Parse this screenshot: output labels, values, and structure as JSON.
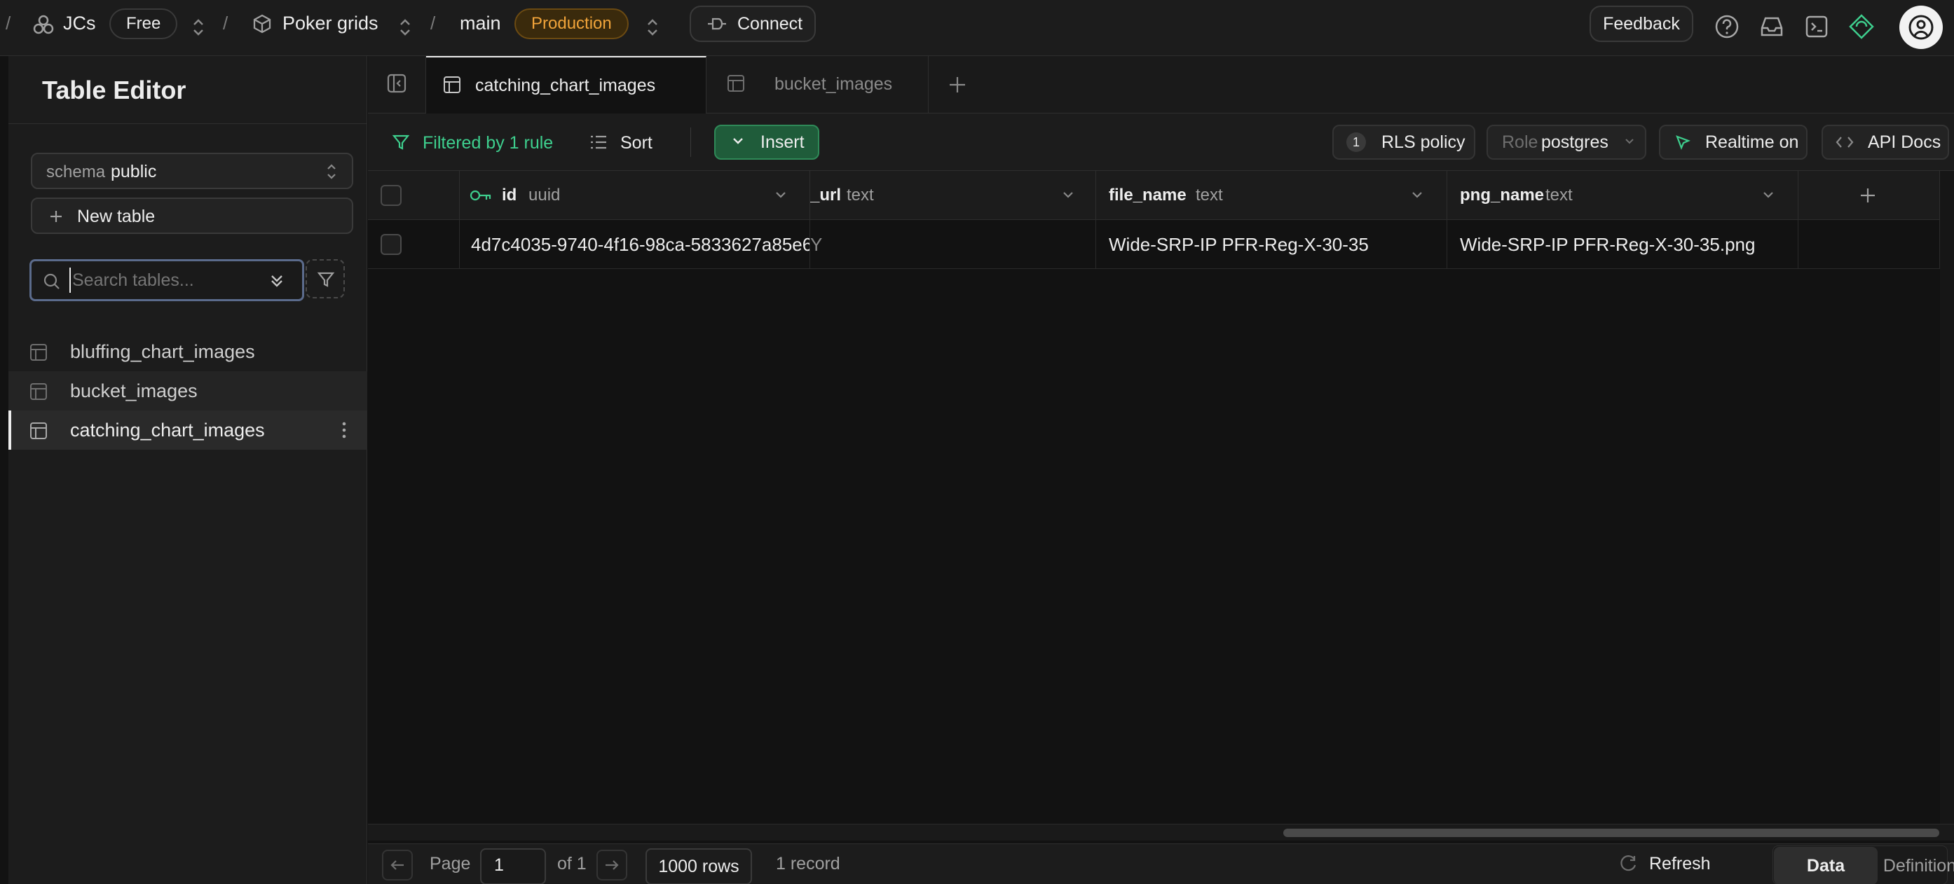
{
  "topbar": {
    "org_name": "JCs",
    "plan_badge": "Free",
    "project_name": "Poker grids",
    "branch_name": "main",
    "env_badge": "Production",
    "connect_label": "Connect",
    "feedback_label": "Feedback"
  },
  "sidebar": {
    "title": "Table Editor",
    "schema_label": "schema",
    "schema_value": "public",
    "new_table_label": "New table",
    "search_placeholder": "Search tables...",
    "tables": [
      {
        "name": "bluffing_chart_images"
      },
      {
        "name": "bucket_images"
      },
      {
        "name": "catching_chart_images"
      }
    ]
  },
  "tabs": [
    {
      "label": "catching_chart_images",
      "active": true
    },
    {
      "label": "bucket_images",
      "active": false
    }
  ],
  "toolbar": {
    "filter_label": "Filtered by 1 rule",
    "sort_label": "Sort",
    "insert_label": "Insert",
    "rls_count": "1",
    "rls_label": "RLS policy",
    "role_label": "Role",
    "role_value": "postgres",
    "realtime_label": "Realtime on",
    "api_docs_label": "API Docs"
  },
  "grid": {
    "columns": [
      {
        "name": "id",
        "type": "uuid"
      },
      {
        "name": "_url",
        "type": "text"
      },
      {
        "name": "file_name",
        "type": "text"
      },
      {
        "name": "png_name",
        "type": "text"
      }
    ],
    "rows": [
      {
        "id": "4d7c4035-9740-4f16-98ca-5833627a85e6",
        "url": "Y",
        "file_name": "Wide-SRP-IP PFR-Reg-X-30-35",
        "png_name": "Wide-SRP-IP PFR-Reg-X-30-35.png"
      }
    ]
  },
  "footer": {
    "page_label": "Page",
    "page_value": "1",
    "of_label": "of 1",
    "rows_value": "1000 rows",
    "record_count": "1 record",
    "refresh_label": "Refresh",
    "data_tab": "Data",
    "definition_tab": "Definition"
  },
  "colors": {
    "accent_green": "#3ecf8e",
    "insert_bg": "#1f5c3a",
    "production": "#f1a43a"
  }
}
